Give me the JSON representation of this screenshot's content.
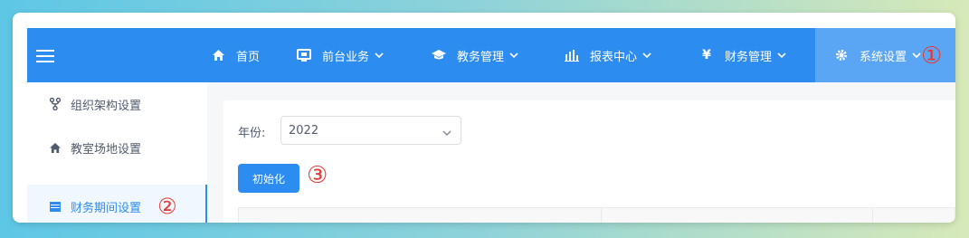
{
  "header": {
    "nav": [
      {
        "label": "首页",
        "icon": "home-icon",
        "has_dropdown": false
      },
      {
        "label": "前台业务",
        "icon": "monitor-icon",
        "has_dropdown": true
      },
      {
        "label": "教务管理",
        "icon": "graduation-cap-icon",
        "has_dropdown": true
      },
      {
        "label": "报表中心",
        "icon": "bar-chart-icon",
        "has_dropdown": true
      },
      {
        "label": "财务管理",
        "icon": "yen-icon",
        "has_dropdown": true
      },
      {
        "label": "系统设置",
        "icon": "gear-icon",
        "has_dropdown": true,
        "active": true
      }
    ]
  },
  "sidebar": {
    "items": [
      {
        "label": "组织架构设置",
        "icon": "org-structure-icon"
      },
      {
        "label": "教室场地设置",
        "icon": "home-icon"
      },
      {
        "label": "财务期间设置",
        "icon": "calendar-icon",
        "active": true
      }
    ]
  },
  "main": {
    "year_label": "年份:",
    "year_value": "2022",
    "init_button": "初始化"
  },
  "annotations": {
    "step1": "①",
    "step2": "②",
    "step3": "③"
  },
  "colors": {
    "primary": "#2d8cf0",
    "active_nav": "#5aa6f5",
    "annotation": "#e53935"
  }
}
